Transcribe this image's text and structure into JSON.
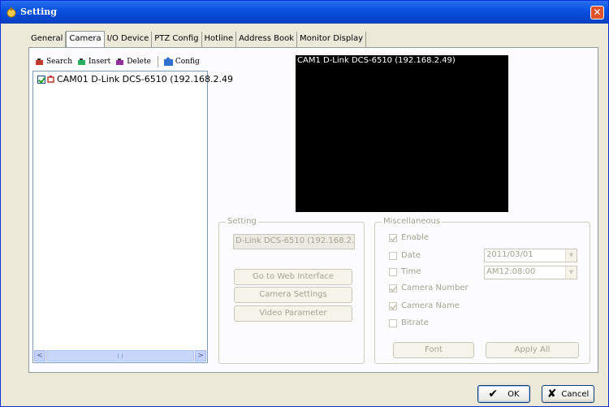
{
  "window": {
    "title": "Setting",
    "close_glyph": "✕"
  },
  "tabs": [
    {
      "label": "General",
      "active": false
    },
    {
      "label": "Camera",
      "active": true
    },
    {
      "label": "I/O Device",
      "active": false
    },
    {
      "label": "PTZ Config",
      "active": false
    },
    {
      "label": "Hotline",
      "active": false
    },
    {
      "label": "Address Book",
      "active": false
    },
    {
      "label": "Monitor Display",
      "active": false
    }
  ],
  "toolbar": {
    "search_label": "Search",
    "insert_label": "Insert",
    "delete_label": "Delete",
    "config_label": "Config"
  },
  "camera_list": {
    "items": [
      {
        "label": "CAM01 D-Link DCS-6510 (192.168.2.49",
        "checked": true
      }
    ],
    "scroll_left": "<",
    "scroll_right": ">"
  },
  "preview": {
    "label": "CAM1 D-Link DCS-6510 (192.168.2.49)"
  },
  "setting": {
    "title": "Setting",
    "name_value": "D-Link DCS-6510 (192.168.2.49",
    "go_web_label": "Go to Web Interface",
    "camera_settings_label": "Camera Settings",
    "video_parameter_label": "Video Parameter"
  },
  "misc": {
    "title": "Miscellaneous",
    "enable_label": "Enable",
    "date_label": "Date",
    "date_value": "2011/03/01",
    "time_label": "Time",
    "time_value": "AM12:08:00",
    "camera_number_label": "Camera Number",
    "camera_name_label": "Camera Name",
    "bitrate_label": "Bitrate",
    "font_label": "Font",
    "apply_all_label": "Apply All"
  },
  "footer": {
    "ok_label": "OK",
    "cancel_label": "Cancel",
    "ok_glyph": "✔",
    "cancel_glyph": "✘"
  },
  "colors": {
    "titlebar": "#0a53e2",
    "panel": "#fcfcfe",
    "window_bg": "#ece9d8",
    "disabled_text": "#a3a392"
  }
}
